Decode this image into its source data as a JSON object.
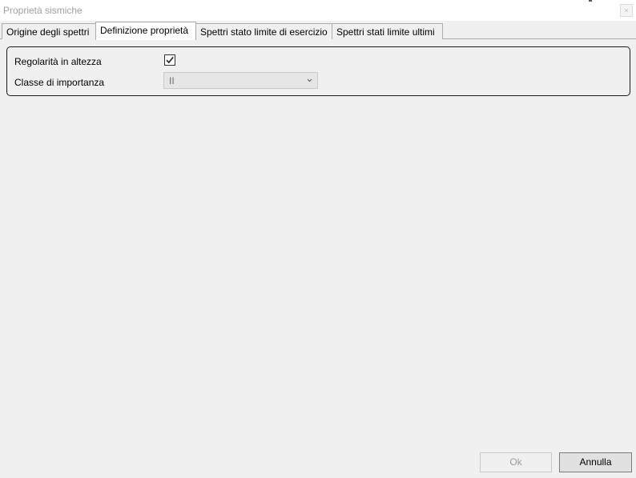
{
  "window": {
    "title": "Proprietà sismiche",
    "close_glyph": "×"
  },
  "tabs": [
    {
      "label": "Origine degli spettri",
      "selected": false
    },
    {
      "label": "Definizione proprietà",
      "selected": true
    },
    {
      "label": "Spettri stato limite di esercizio",
      "selected": false
    },
    {
      "label": "Spettri stati limite ultimi",
      "selected": false
    }
  ],
  "form": {
    "regularity_label": "Regolarità in altezza",
    "regularity_checked": true,
    "importance_label": "Classe di importanza",
    "importance_value": "II"
  },
  "buttons": {
    "ok_label": "Ok",
    "ok_enabled": false,
    "cancel_label": "Annulla"
  },
  "icons": {
    "close": "close-icon",
    "check": "checkmark-icon",
    "dropdown": "chevron-down-icon"
  }
}
